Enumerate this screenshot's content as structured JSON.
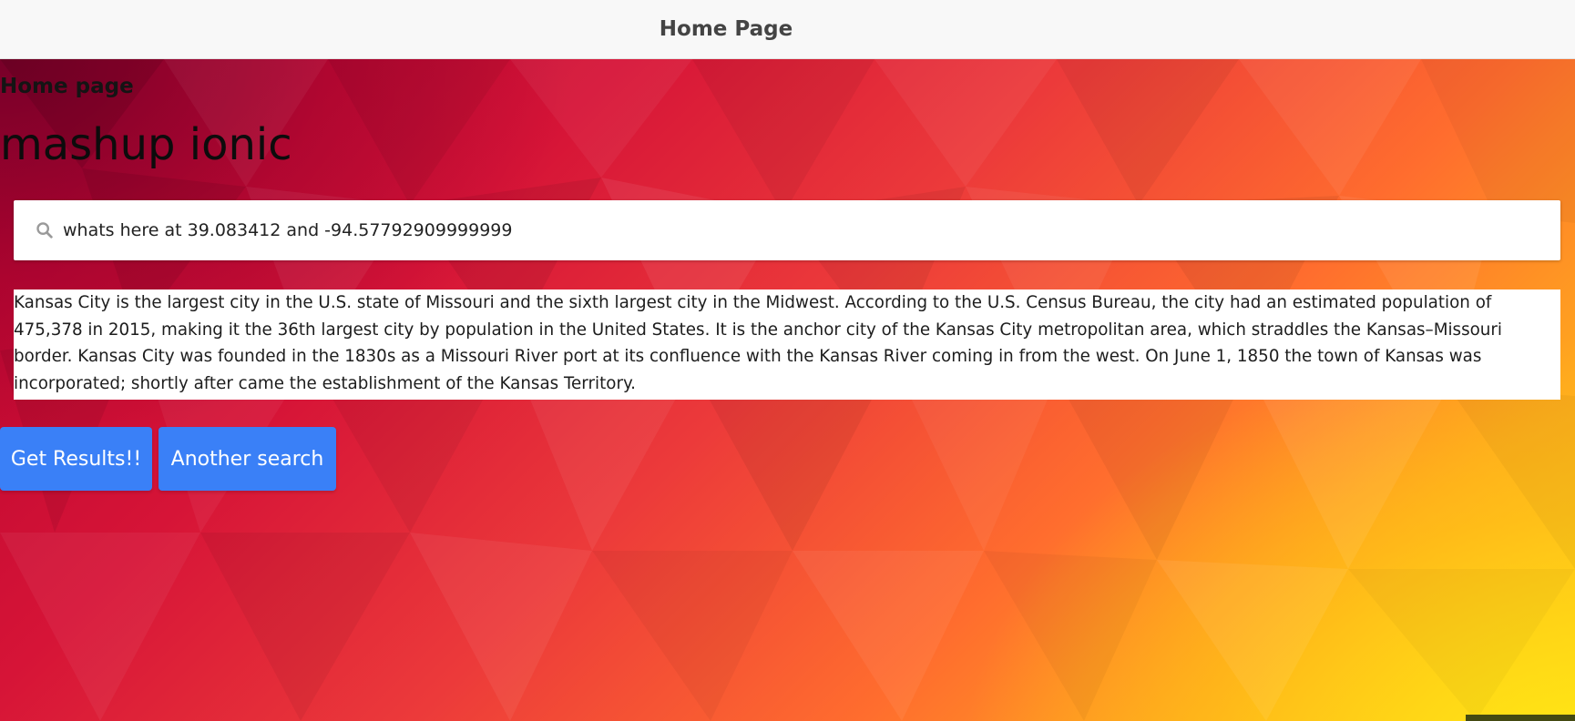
{
  "toolbar": {
    "title": "Home Page"
  },
  "page": {
    "label": "Home page",
    "heading": "mashup ionic"
  },
  "search": {
    "icon": "search-icon",
    "value": "whats here at 39.083412 and -94.57792909999999"
  },
  "summary": {
    "text": "Kansas City is the largest city in the U.S. state of Missouri and the sixth largest city in the Midwest. According to the U.S. Census Bureau, the city had an estimated population of 475,378 in 2015, making it the 36th largest city by population in the United States. It is the anchor city of the Kansas City metropolitan area, which straddles the Kansas–Missouri border. Kansas City was founded in the 1830s as a Missouri River port at its confluence with the Kansas River coming in from the west. On June 1, 1850 the town of Kansas was incorporated; shortly after came the establishment of the Kansas Territory."
  },
  "buttons": {
    "get_results": "Get Results!!",
    "another_search": "Another search"
  },
  "colors": {
    "toolbar_bg": "#f8f8f8",
    "button_bg": "#3a80f7",
    "gradient_start": "#b0002e",
    "gradient_mid": "#ff6d2e",
    "gradient_end": "#ffd21a"
  }
}
